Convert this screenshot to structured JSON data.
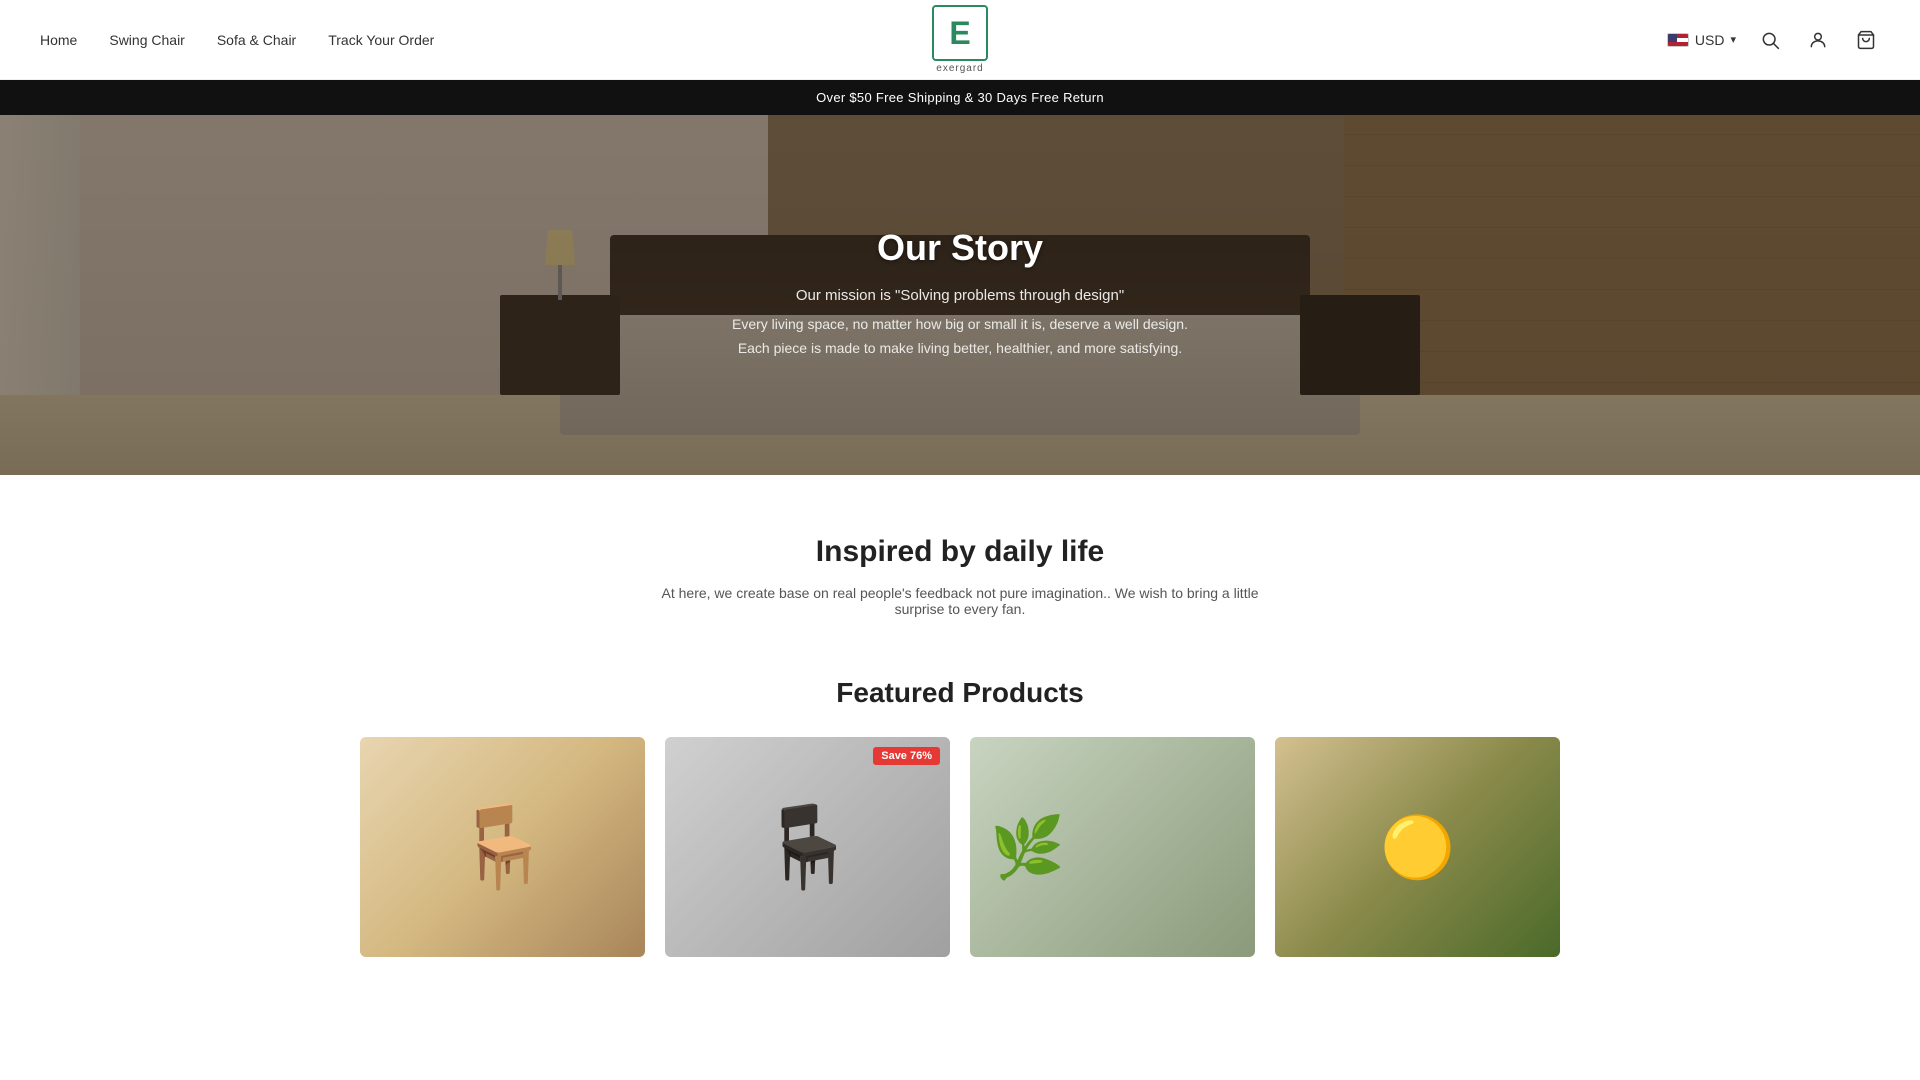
{
  "header": {
    "nav_left": [
      {
        "label": "Home",
        "id": "home"
      },
      {
        "label": "Swing Chair",
        "id": "swing-chair"
      },
      {
        "label": "Sofa & Chair",
        "id": "sofa-chair"
      },
      {
        "label": "Track Your Order",
        "id": "track-order"
      }
    ],
    "logo": {
      "letter": "E",
      "brand": "exergard"
    },
    "currency": {
      "code": "USD",
      "flag": "us"
    }
  },
  "promo_banner": {
    "text": "Over $50 Free Shipping & 30 Days Free Return"
  },
  "hero": {
    "title": "Our Story",
    "mission": "Our mission is \"Solving problems through design\"",
    "desc1": "Every living space, no matter how big or small it is, deserve a well design.",
    "desc2": "Each piece is made to make living better, healthier, and more satisfying."
  },
  "inspired": {
    "title": "Inspired by daily life",
    "desc": "At here, we create base on real people's feedback not pure imagination.. We wish to bring a little surprise to every fan."
  },
  "featured": {
    "title": "Featured Products",
    "products": [
      {
        "id": "p1",
        "img_class": "product-img-1",
        "save_badge": null
      },
      {
        "id": "p2",
        "img_class": "product-img-2",
        "save_badge": "Save 76%"
      },
      {
        "id": "p3",
        "img_class": "product-img-3",
        "save_badge": null
      },
      {
        "id": "p4",
        "img_class": "product-img-4",
        "save_badge": null
      }
    ]
  }
}
